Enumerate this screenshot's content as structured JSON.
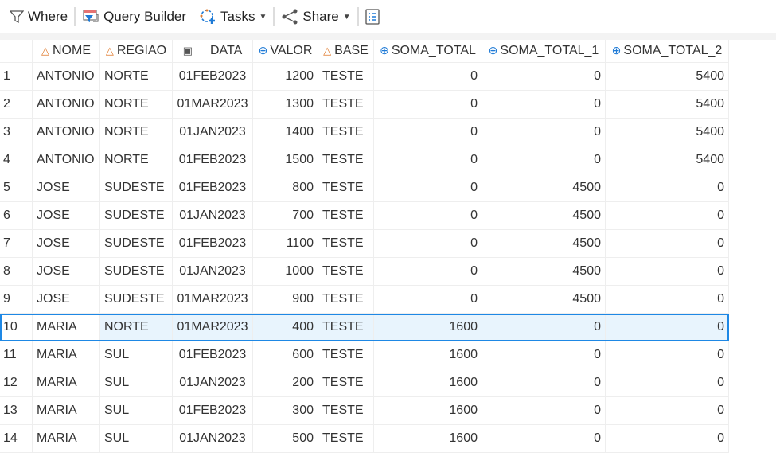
{
  "toolbar": {
    "where": "Where",
    "query_builder": "Query Builder",
    "tasks": "Tasks",
    "share": "Share"
  },
  "columns": [
    {
      "label": "NOME",
      "type": "char"
    },
    {
      "label": "REGIAO",
      "type": "char"
    },
    {
      "label": "DATA",
      "type": "date"
    },
    {
      "label": "VALOR",
      "type": "num"
    },
    {
      "label": "BASE",
      "type": "char"
    },
    {
      "label": "SOMA_TOTAL",
      "type": "num"
    },
    {
      "label": "SOMA_TOTAL_1",
      "type": "num"
    },
    {
      "label": "SOMA_TOTAL_2",
      "type": "num"
    }
  ],
  "selected_row": 10,
  "rows": [
    [
      "1",
      "ANTONIO",
      "NORTE",
      "01FEB2023",
      "1200",
      "TESTE",
      "0",
      "0",
      "5400"
    ],
    [
      "2",
      "ANTONIO",
      "NORTE",
      "01MAR2023",
      "1300",
      "TESTE",
      "0",
      "0",
      "5400"
    ],
    [
      "3",
      "ANTONIO",
      "NORTE",
      "01JAN2023",
      "1400",
      "TESTE",
      "0",
      "0",
      "5400"
    ],
    [
      "4",
      "ANTONIO",
      "NORTE",
      "01FEB2023",
      "1500",
      "TESTE",
      "0",
      "0",
      "5400"
    ],
    [
      "5",
      "JOSE",
      "SUDESTE",
      "01FEB2023",
      "800",
      "TESTE",
      "0",
      "4500",
      "0"
    ],
    [
      "6",
      "JOSE",
      "SUDESTE",
      "01JAN2023",
      "700",
      "TESTE",
      "0",
      "4500",
      "0"
    ],
    [
      "7",
      "JOSE",
      "SUDESTE",
      "01FEB2023",
      "1100",
      "TESTE",
      "0",
      "4500",
      "0"
    ],
    [
      "8",
      "JOSE",
      "SUDESTE",
      "01JAN2023",
      "1000",
      "TESTE",
      "0",
      "4500",
      "0"
    ],
    [
      "9",
      "JOSE",
      "SUDESTE",
      "01MAR2023",
      "900",
      "TESTE",
      "0",
      "4500",
      "0"
    ],
    [
      "10",
      "MARIA",
      "NORTE",
      "01MAR2023",
      "400",
      "TESTE",
      "1600",
      "0",
      "0"
    ],
    [
      "11",
      "MARIA",
      "SUL",
      "01FEB2023",
      "600",
      "TESTE",
      "1600",
      "0",
      "0"
    ],
    [
      "12",
      "MARIA",
      "SUL",
      "01JAN2023",
      "200",
      "TESTE",
      "1600",
      "0",
      "0"
    ],
    [
      "13",
      "MARIA",
      "SUL",
      "01FEB2023",
      "300",
      "TESTE",
      "1600",
      "0",
      "0"
    ],
    [
      "14",
      "MARIA",
      "SUL",
      "01JAN2023",
      "500",
      "TESTE",
      "1600",
      "0",
      "0"
    ]
  ]
}
